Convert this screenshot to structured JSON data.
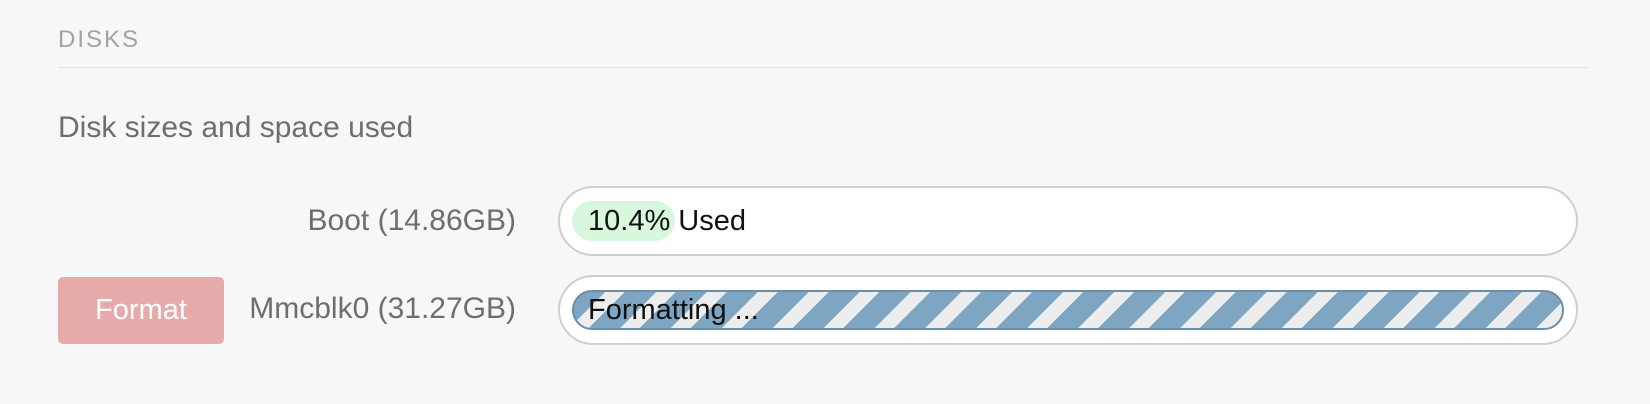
{
  "section": {
    "title": "DISKS",
    "description": "Disk sizes and space used"
  },
  "disks": [
    {
      "label": "Boot (14.86GB)",
      "status_text": "10.4% Used",
      "used_fraction": 0.104,
      "state": "normal"
    },
    {
      "label": "Mmcblk0 (31.27GB)",
      "status_text": "Formatting ...",
      "state": "formatting",
      "action_label": "Format"
    }
  ],
  "colors": {
    "used_fill": "#d8f8de",
    "format_button": "#e6aaab",
    "stripe_blue": "#7ea6c2",
    "stripe_light": "#ededed"
  }
}
